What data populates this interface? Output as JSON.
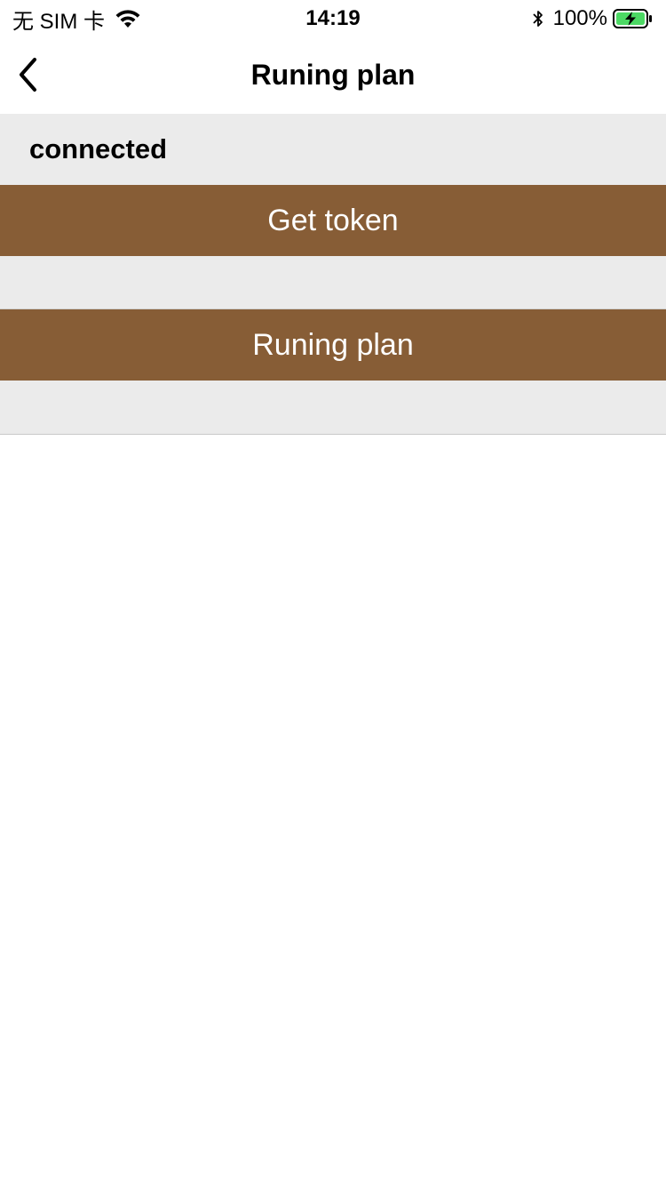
{
  "status_bar": {
    "carrier": "无 SIM 卡",
    "time": "14:19",
    "battery": "100%",
    "icons": [
      "wifi-icon",
      "bluetooth-icon",
      "battery-charging-icon"
    ]
  },
  "nav": {
    "title": "Runing plan",
    "back_icon": "chevron-left-icon"
  },
  "main": {
    "status": "connected",
    "get_token_label": "Get token",
    "running_plan_label": "Runing plan"
  },
  "colors": {
    "button_bg": "#875d36",
    "button_text": "#ffffff",
    "content_bg": "#ebebeb",
    "battery_fill": "#4cd964"
  }
}
